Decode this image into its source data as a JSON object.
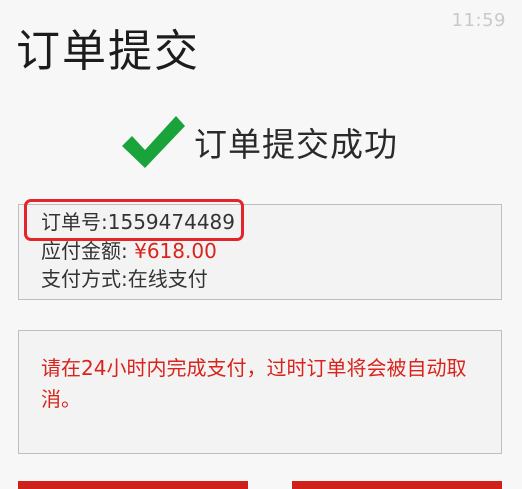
{
  "status_bar": {
    "time": "11:59"
  },
  "header": {
    "title": "订单提交"
  },
  "success": {
    "icon": "checkmark-icon",
    "message": "订单提交成功"
  },
  "order": {
    "number_label": "订单号:",
    "number_value": "1559474489",
    "amount_label": "应付金额:",
    "amount_value": "¥618.00",
    "payment_label": "支付方式:",
    "payment_value": "在线支付"
  },
  "notice": {
    "text": "请在24小时内完成支付，过时订单将会被自动取消。"
  },
  "colors": {
    "accent_red": "#d9231c",
    "check_green": "#1aa33a",
    "highlight_red": "#e3242b"
  }
}
